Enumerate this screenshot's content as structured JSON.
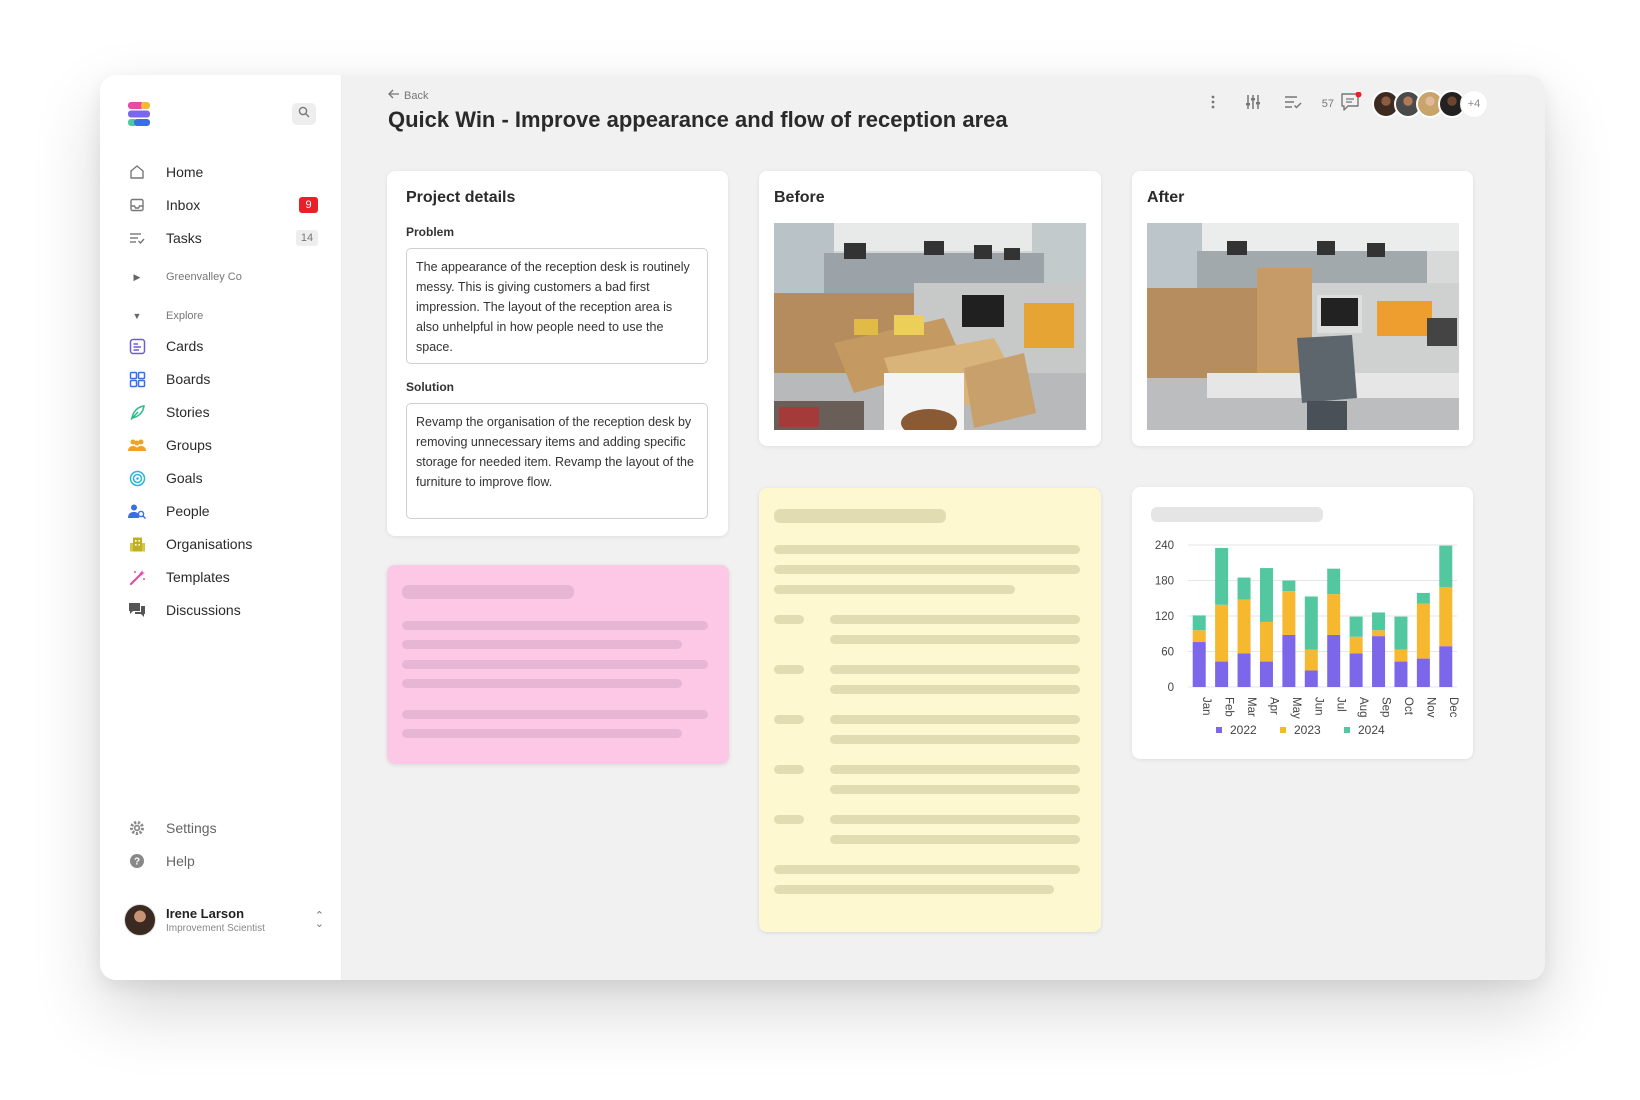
{
  "sidebar": {
    "nav_main": [
      {
        "label": "Home",
        "icon": "home-icon"
      },
      {
        "label": "Inbox",
        "icon": "inbox-icon",
        "badge": "9"
      },
      {
        "label": "Tasks",
        "icon": "tasks-icon",
        "badge": "14"
      }
    ],
    "workspace": "Greenvalley Co",
    "explore_label": "Explore",
    "nav_explore": [
      {
        "label": "Cards",
        "icon": "cards-icon",
        "color": "#6b5bd6"
      },
      {
        "label": "Boards",
        "icon": "boards-icon",
        "color": "#3a6fe0"
      },
      {
        "label": "Stories",
        "icon": "stories-icon",
        "color": "#2bb88a"
      },
      {
        "label": "Groups",
        "icon": "groups-icon",
        "color": "#f0a31c"
      },
      {
        "label": "Goals",
        "icon": "goals-icon",
        "color": "#2bb5d8"
      },
      {
        "label": "People",
        "icon": "people-icon",
        "color": "#3a6fe0"
      },
      {
        "label": "Organisations",
        "icon": "organisations-icon",
        "color": "#c0b020"
      },
      {
        "label": "Templates",
        "icon": "templates-icon",
        "color": "#e84aa8"
      },
      {
        "label": "Discussions",
        "icon": "discussions-icon",
        "color": "#555555"
      }
    ],
    "settings_label": "Settings",
    "help_label": "Help",
    "user": {
      "name": "Irene Larson",
      "role": "Improvement Scientist"
    }
  },
  "header": {
    "back_label": "Back",
    "title": "Quick Win - Improve appearance and flow of reception area",
    "comment_count": "57",
    "extra_collaborators": "+4"
  },
  "project_details": {
    "title": "Project details",
    "problem_label": "Problem",
    "problem_text": "The appearance of the reception desk is routinely messy. This is giving customers a bad first impression. The layout of the reception area is also unhelpful in how people need to use the space.",
    "solution_label": "Solution",
    "solution_text": "Revamp the organisation of the reception desk by removing unnecessary items and adding specific storage for needed item. Revamp the layout of the furniture to improve flow."
  },
  "before": {
    "title": "Before"
  },
  "after": {
    "title": "After"
  },
  "colors": {
    "accent_red": "#e9202a",
    "pink_card": "#fdc8e6",
    "yellow_card": "#fef8d0",
    "s2022": "#7c66ea",
    "s2023": "#f5b82e",
    "s2024": "#52c7a0"
  },
  "chart_data": {
    "type": "bar",
    "stacked": true,
    "categories": [
      "Jan",
      "Feb",
      "Mar",
      "Apr",
      "May",
      "Jun",
      "Jul",
      "Aug",
      "Sep",
      "Oct",
      "Nov",
      "Dec"
    ],
    "series": [
      {
        "name": "2022",
        "values": [
          76,
          43,
          57,
          43,
          88,
          28,
          88,
          57,
          86,
          43,
          48,
          69
        ]
      },
      {
        "name": "2023",
        "values": [
          20,
          96,
          91,
          67,
          74,
          35,
          69,
          28,
          10,
          20,
          93,
          100
        ]
      },
      {
        "name": "2024",
        "values": [
          25,
          96,
          37,
          91,
          18,
          90,
          43,
          34,
          30,
          56,
          18,
          70
        ]
      }
    ],
    "ylim": [
      0,
      240
    ],
    "yticks": [
      0,
      60,
      120,
      180,
      240
    ],
    "legend_position": "bottom",
    "grid": true
  }
}
